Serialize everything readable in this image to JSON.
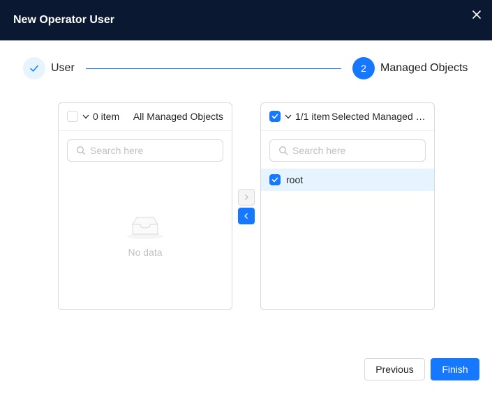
{
  "modal": {
    "title": "New Operator User",
    "close_icon": "close-icon"
  },
  "steps": [
    {
      "label": "User",
      "status": "finished",
      "icon": "check-icon"
    },
    {
      "label": "Managed Objects",
      "number": "2",
      "status": "current"
    }
  ],
  "transfer": {
    "left": {
      "count_text": "0 item",
      "title": "All Managed Objects",
      "search_placeholder": "Search here",
      "empty_text": "No data",
      "select_all_checked": false
    },
    "right": {
      "count_text": "1/1 item",
      "title": "Selected Managed Objects",
      "search_placeholder": "Search here",
      "select_all_checked": true,
      "items": [
        {
          "label": "root",
          "checked": true
        }
      ]
    },
    "move_right_icon": "chevron-right-icon",
    "move_left_icon": "chevron-left-icon"
  },
  "footer": {
    "previous_label": "Previous",
    "finish_label": "Finish"
  },
  "colors": {
    "header_bg": "#0a1931",
    "primary": "#1677ff",
    "selected_row": "#e6f4ff"
  }
}
